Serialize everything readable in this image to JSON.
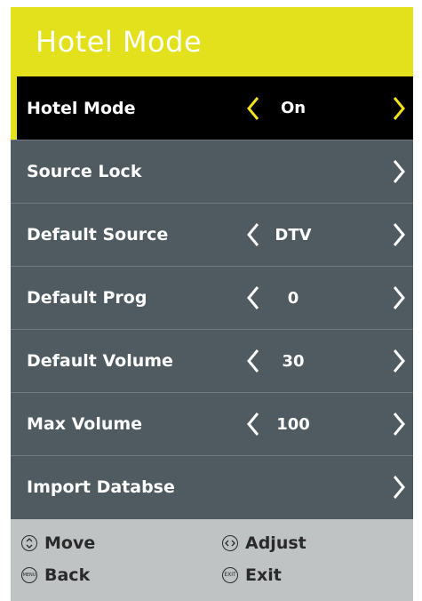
{
  "header": {
    "title": "Hotel Mode"
  },
  "menu": {
    "items": [
      {
        "label": "Hotel Mode",
        "value": "On",
        "selected": true,
        "has_left": true
      },
      {
        "label": "Source Lock",
        "value": "",
        "selected": false,
        "has_left": false
      },
      {
        "label": "Default Source",
        "value": "DTV",
        "selected": false,
        "has_left": true
      },
      {
        "label": "Default Prog",
        "value": "0",
        "selected": false,
        "has_left": true
      },
      {
        "label": "Default Volume",
        "value": "30",
        "selected": false,
        "has_left": true
      },
      {
        "label": "Max Volume",
        "value": "100",
        "selected": false,
        "has_left": true
      },
      {
        "label": "Import Databse",
        "value": "",
        "selected": false,
        "has_left": false
      }
    ]
  },
  "footer": {
    "move": "Move",
    "adjust": "Adjust",
    "back": "Back",
    "exit": "Exit",
    "menu_icon_text": "MENU",
    "exit_icon_text": "EXIT"
  },
  "colors": {
    "accent": "#e3e11b",
    "panel": "#4f5b60",
    "selected_bg": "#000000",
    "footer": "#bfc3c4"
  }
}
